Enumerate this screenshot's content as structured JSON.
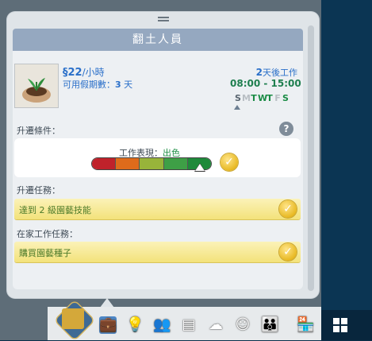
{
  "panel": {
    "title": "翻土人員",
    "pay_symbol": "§",
    "pay_amount": "22",
    "pay_unit": "/小時",
    "pto_label": "可用假期數：",
    "pto_value": "3",
    "pto_unit": " 天",
    "next_work_num": "2",
    "next_work_text": "天後工作",
    "hours": "08:00 -  15:00",
    "days": [
      "S",
      "M",
      "T",
      "W",
      "T",
      "F",
      "S"
    ]
  },
  "promotion": {
    "label": "升遷條件：",
    "help": "?",
    "performance_label": "工作表現：",
    "performance_level": "出色",
    "performance_value": 0.9
  },
  "tasks": {
    "label": "升遷任務：",
    "items": [
      {
        "text": "達到 2 級園藝技能"
      }
    ]
  },
  "wfh": {
    "label": "在家工作任務：",
    "items": [
      {
        "text": "購買園藝種子"
      }
    ]
  },
  "colors": {
    "accent": "#2a6fc9",
    "title_bar": "#95a8c0",
    "task_yellow": "#f6e68a",
    "perf_segments": [
      "#c0222b",
      "#de6b1b",
      "#98b43a",
      "#3e9f46",
      "#1f8a3a"
    ]
  },
  "toolbar_icons": [
    "career-icon",
    "briefcase-icon",
    "lightbulb-icon",
    "relationships-icon",
    "inventory-icon",
    "aspiration-icon",
    "skills-icon",
    "household-icon",
    "buy-icon"
  ]
}
